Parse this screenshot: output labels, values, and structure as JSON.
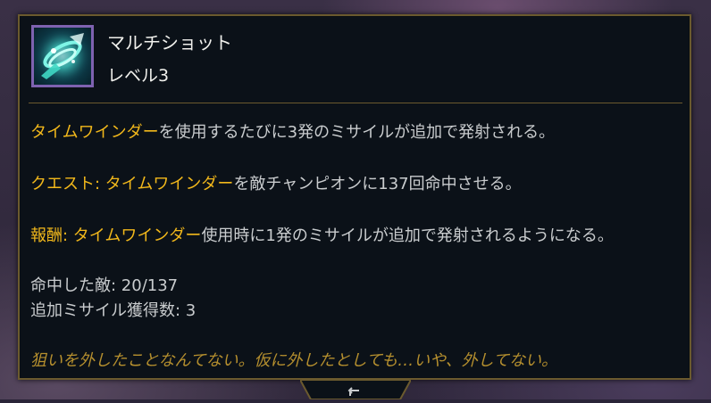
{
  "tooltip": {
    "title": "マルチショット",
    "level": "レベル3",
    "icon": "multishot-ability-icon",
    "line1": {
      "highlight": "タイムワインダー",
      "text": "を使用するたびに3発のミサイルが追加で発射される。"
    },
    "line2": {
      "label": "クエスト: ",
      "highlight": "タイムワインダー",
      "text": "を敵チャンピオンに137回命中させる。"
    },
    "line3": {
      "label": "報酬: ",
      "highlight": "タイムワインダー",
      "text": "使用時に1発のミサイルが追加で発射されるようになる。"
    },
    "stat1": "命中した敵: 20/137",
    "stat2": "追加ミサイル獲得数: 3",
    "flavor": "狙いを外したことなんてない。仮に外したとしても…いや、外してない。"
  },
  "colors": {
    "highlight": "#f2b81b",
    "body_text": "#c9ccce",
    "flavor_text": "#b58f2e",
    "border": "#6b5a2e",
    "icon_frame": "#7e62b0"
  }
}
